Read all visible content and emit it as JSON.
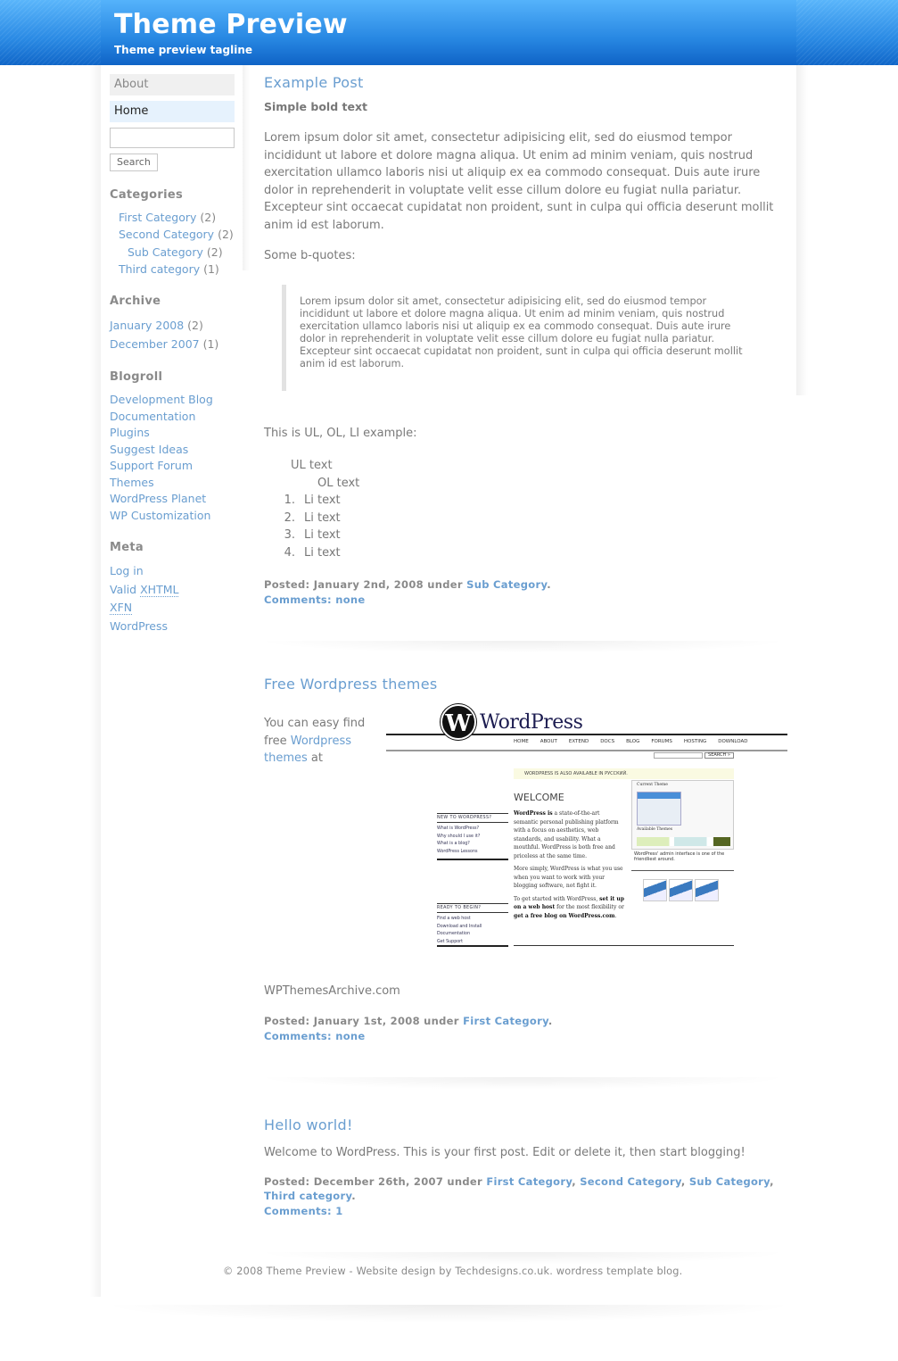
{
  "header": {
    "title": "Theme Preview",
    "tagline": "Theme preview tagline",
    "gradient_top": "#55b3fb",
    "gradient_bottom": "#0f63c6"
  },
  "sidebar": {
    "pages": [
      {
        "label": "About",
        "active": false
      },
      {
        "label": "Home",
        "active": true
      }
    ],
    "search": {
      "value": "",
      "placeholder": "",
      "button_label": "Search"
    },
    "categories": {
      "heading": "Categories",
      "items": [
        {
          "label": "First Category",
          "count": "(2)",
          "level": 0
        },
        {
          "label": "Second Category",
          "count": "(2)",
          "level": 0
        },
        {
          "label": "Sub Category",
          "count": "(2)",
          "level": 1
        },
        {
          "label": "Third category",
          "count": "(1)",
          "level": 0
        }
      ]
    },
    "archive": {
      "heading": "Archive",
      "items": [
        {
          "label": "January 2008",
          "count": "(2)"
        },
        {
          "label": "December 2007",
          "count": "(1)"
        }
      ]
    },
    "blogroll": {
      "heading": "Blogroll",
      "items": [
        "Development Blog",
        "Documentation",
        "Plugins",
        "Suggest Ideas",
        "Support Forum",
        "Themes",
        "WordPress Planet",
        "WP Customization"
      ]
    },
    "meta": {
      "heading": "Meta",
      "items": [
        {
          "label": "Log in"
        },
        {
          "prefix": "Valid ",
          "abbr": "XHTML"
        },
        {
          "abbr": "XFN"
        },
        {
          "label": "WordPress"
        }
      ]
    }
  },
  "posts": [
    {
      "title": "Example Post",
      "bold_text": "Simple bold text",
      "paragraph": "Lorem ipsum dolor sit amet, consectetur adipisicing elit, sed do eiusmod tempor incididunt ut labore et dolore magna aliqua. Ut enim ad minim veniam, quis nostrud exercitation ullamco laboris nisi ut aliquip ex ea commodo consequat. Duis aute irure dolor in reprehenderit in voluptate velit esse cillum dolore eu fugiat nulla pariatur. Excepteur sint occaecat cupidatat non proident, sunt in culpa qui officia deserunt mollit anim id est laborum.",
      "bquote_intro": "Some b-quotes:",
      "blockquote": "Lorem ipsum dolor sit amet, consectetur adipisicing elit, sed do eiusmod tempor incididunt ut labore et dolore magna aliqua. Ut enim ad minim veniam, quis nostrud exercitation ullamco laboris nisi ut aliquip ex ea commodo consequat. Duis aute irure dolor in reprehenderit in voluptate velit esse cillum dolore eu fugiat nulla pariatur. Excepteur sint occaecat cupidatat non proident, sunt in culpa qui officia deserunt mollit anim id est laborum.",
      "list_intro": "This is UL, OL, LI example:",
      "ul_text": "UL text",
      "ol_text": "OL text",
      "li_items": [
        {
          "num": "1.",
          "text": "Li text"
        },
        {
          "num": "2.",
          "text": "Li text"
        },
        {
          "num": "3.",
          "text": "Li text"
        },
        {
          "num": "4.",
          "text": "Li text"
        }
      ],
      "posted_prefix": "Posted: January 2nd, 2008 under ",
      "categories": [
        "Sub Category"
      ],
      "comments": "Comments: none"
    },
    {
      "title": "Free Wordpress themes",
      "text_before": "You can easy find free ",
      "link_text": "Wordpress themes",
      "text_after": " at",
      "image": {
        "logo_glyph": "W",
        "logo_word": "WordPress",
        "nav": [
          "HOME",
          "ABOUT",
          "EXTEND",
          "DOCS",
          "BLOG",
          "FORUMS",
          "HOSTING",
          "DOWNLOAD"
        ],
        "search_button": "SEARCH »",
        "notice": "WORDPRESS IS ALSO AVAILABLE IN РУССКИЙ.",
        "welcome": "WELCOME",
        "body_bold": "WordPress is",
        "body_1": " a state-of-the-art semantic personal publishing platform with a focus on aesthetics, web standards, and usability. What a mouthful. WordPress is both free and priceless at the same time.",
        "body_2": "More simply, WordPress is what you use when you want to work with your blogging software, not fight it.",
        "body_3a": "To get started with WordPress, ",
        "body_3_link1": "set it up on a web host",
        "body_3b": " for the most flexibility or ",
        "body_3_link2": "get a free blog on WordPress.com",
        "body_3c": ".",
        "new_heading": "NEW TO WORDPRESS?",
        "new_items": [
          "What is WordPress?",
          "Why should I use it?",
          "What is a blog?",
          "WordPress Lessons"
        ],
        "ready_heading": "READY TO BEGIN?",
        "ready_items": [
          "Find a web host",
          "Download and Install",
          "Documentation",
          "Get Support"
        ],
        "current_theme": "Current Theme",
        "available_themes": "Available Themes",
        "caption": "WordPress' admin interface is one of the friendliest around."
      },
      "after_image": "WPThemesArchive.com",
      "posted_prefix": "Posted: January 1st, 2008 under ",
      "categories": [
        "First Category"
      ],
      "comments": "Comments: none"
    },
    {
      "title": "Hello world!",
      "paragraph": "Welcome to WordPress. This is your first post. Edit or delete it, then start blogging!",
      "posted_prefix": "Posted: December 26th, 2007 under ",
      "categories": [
        "First Category",
        "Second Category",
        "Sub Category",
        "Third category"
      ],
      "comments": "Comments: 1"
    }
  ],
  "footer": {
    "text": "© 2008 Theme Preview - Website design by Techdesigns.co.uk. wordress template blog."
  },
  "colors": {
    "link": "#6a9ed0",
    "text": "#7a7a7a",
    "home_tab_bg": "#e6f2fd",
    "about_tab_bg": "#f0f0f0"
  }
}
